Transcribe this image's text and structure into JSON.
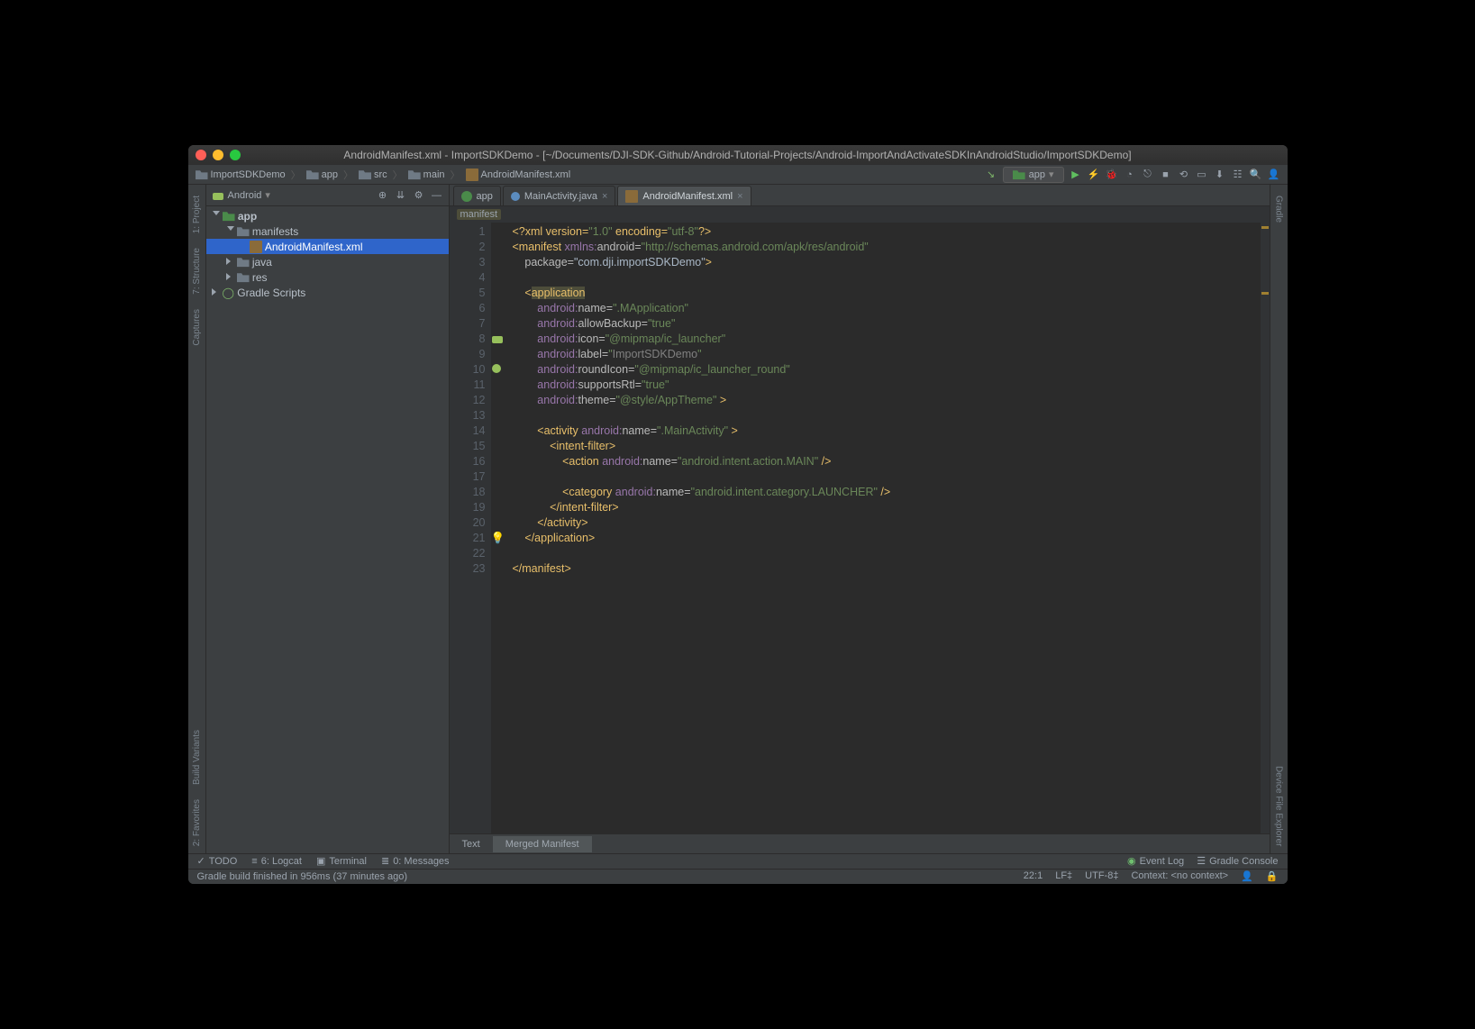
{
  "title": "AndroidManifest.xml - ImportSDKDemo - [~/Documents/DJI-SDK-Github/Android-Tutorial-Projects/Android-ImportAndActivateSDKInAndroidStudio/ImportSDKDemo]",
  "breadcrumbs": [
    "ImportSDKDemo",
    "app",
    "src",
    "main",
    "AndroidManifest.xml"
  ],
  "run_config": "app",
  "project_panel_title": "Android",
  "tree": {
    "app": "app",
    "manifests": "manifests",
    "manifest_file": "AndroidManifest.xml",
    "java": "java",
    "res": "res",
    "gradle": "Gradle Scripts"
  },
  "tabs": [
    {
      "label": "app"
    },
    {
      "label": "MainActivity.java"
    },
    {
      "label": "AndroidManifest.xml"
    }
  ],
  "crumb": "manifest",
  "editor_bottom_tabs": {
    "text": "Text",
    "merged": "Merged Manifest"
  },
  "line_numbers": [
    "1",
    "2",
    "3",
    "4",
    "5",
    "6",
    "7",
    "8",
    "9",
    "10",
    "11",
    "12",
    "13",
    "14",
    "15",
    "16",
    "17",
    "18",
    "19",
    "20",
    "21",
    "22",
    "23"
  ],
  "code": {
    "l1_a": "<?xml version=",
    "l1_b": "\"1.0\"",
    "l1_c": " encoding=",
    "l1_d": "\"utf-8\"",
    "l1_e": "?>",
    "l2_a": "<manifest ",
    "l2_b": "xmlns:",
    "l2_c": "android",
    "l2_d": "=",
    "l2_e": "\"http://schemas.android.com/apk/res/android\"",
    "l3_a": "    package=",
    "l3_b": "\"com.dji.importSDKDemo\"",
    "l3_c": ">",
    "l5_a": "    <",
    "l5_b": "application",
    "l6_a": "        ",
    "l6_b": "android:",
    "l6_c": "name=",
    "l6_d": "\".MApplication\"",
    "l7_a": "        ",
    "l7_b": "android:",
    "l7_c": "allowBackup=",
    "l7_d": "\"true\"",
    "l8_a": "        ",
    "l8_b": "android:",
    "l8_c": "icon=",
    "l8_d": "\"@mipmap/ic_launcher\"",
    "l9_a": "        ",
    "l9_b": "android:",
    "l9_c": "label=",
    "l9_d": "\"",
    "l9_e": "ImportSDKDemo",
    "l9_f": "\"",
    "l10_a": "        ",
    "l10_b": "android:",
    "l10_c": "roundIcon=",
    "l10_d": "\"@mipmap/ic_launcher_round\"",
    "l11_a": "        ",
    "l11_b": "android:",
    "l11_c": "supportsRtl=",
    "l11_d": "\"true\"",
    "l12_a": "        ",
    "l12_b": "android:",
    "l12_c": "theme=",
    "l12_d": "\"@style/AppTheme\"",
    "l12_e": " >",
    "l14_a": "        <activity ",
    "l14_b": "android:",
    "l14_c": "name=",
    "l14_d": "\".MainActivity\"",
    "l14_e": " >",
    "l15_a": "            <intent-filter>",
    "l16_a": "                <action ",
    "l16_b": "android:",
    "l16_c": "name=",
    "l16_d": "\"android.intent.action.MAIN\"",
    "l16_e": " />",
    "l18_a": "                <category ",
    "l18_b": "android:",
    "l18_c": "name=",
    "l18_d": "\"android.intent.category.LAUNCHER\"",
    "l18_e": " />",
    "l19_a": "            </intent-filter>",
    "l20_a": "        </activity>",
    "l21_a": "    </application>",
    "l23_a": "</manifest>"
  },
  "left_rail": {
    "project": "1: Project",
    "structure": "7: Structure",
    "captures": "Captures",
    "favorites": "2: Favorites",
    "build_variants": "Build Variants"
  },
  "right_rail": {
    "gradle": "Gradle",
    "device": "Device File Explorer"
  },
  "bottom_tools": {
    "todo": "TODO",
    "logcat": "6: Logcat",
    "terminal": "Terminal",
    "messages": "0: Messages"
  },
  "status_right": {
    "event_log": "Event Log",
    "gradle_console": "Gradle Console"
  },
  "status_msg": "Gradle build finished in 956ms (37 minutes ago)",
  "status_info": {
    "pos": "22:1",
    "lf": "LF‡",
    "enc": "UTF-8‡",
    "ctx": "Context: <no context>"
  }
}
